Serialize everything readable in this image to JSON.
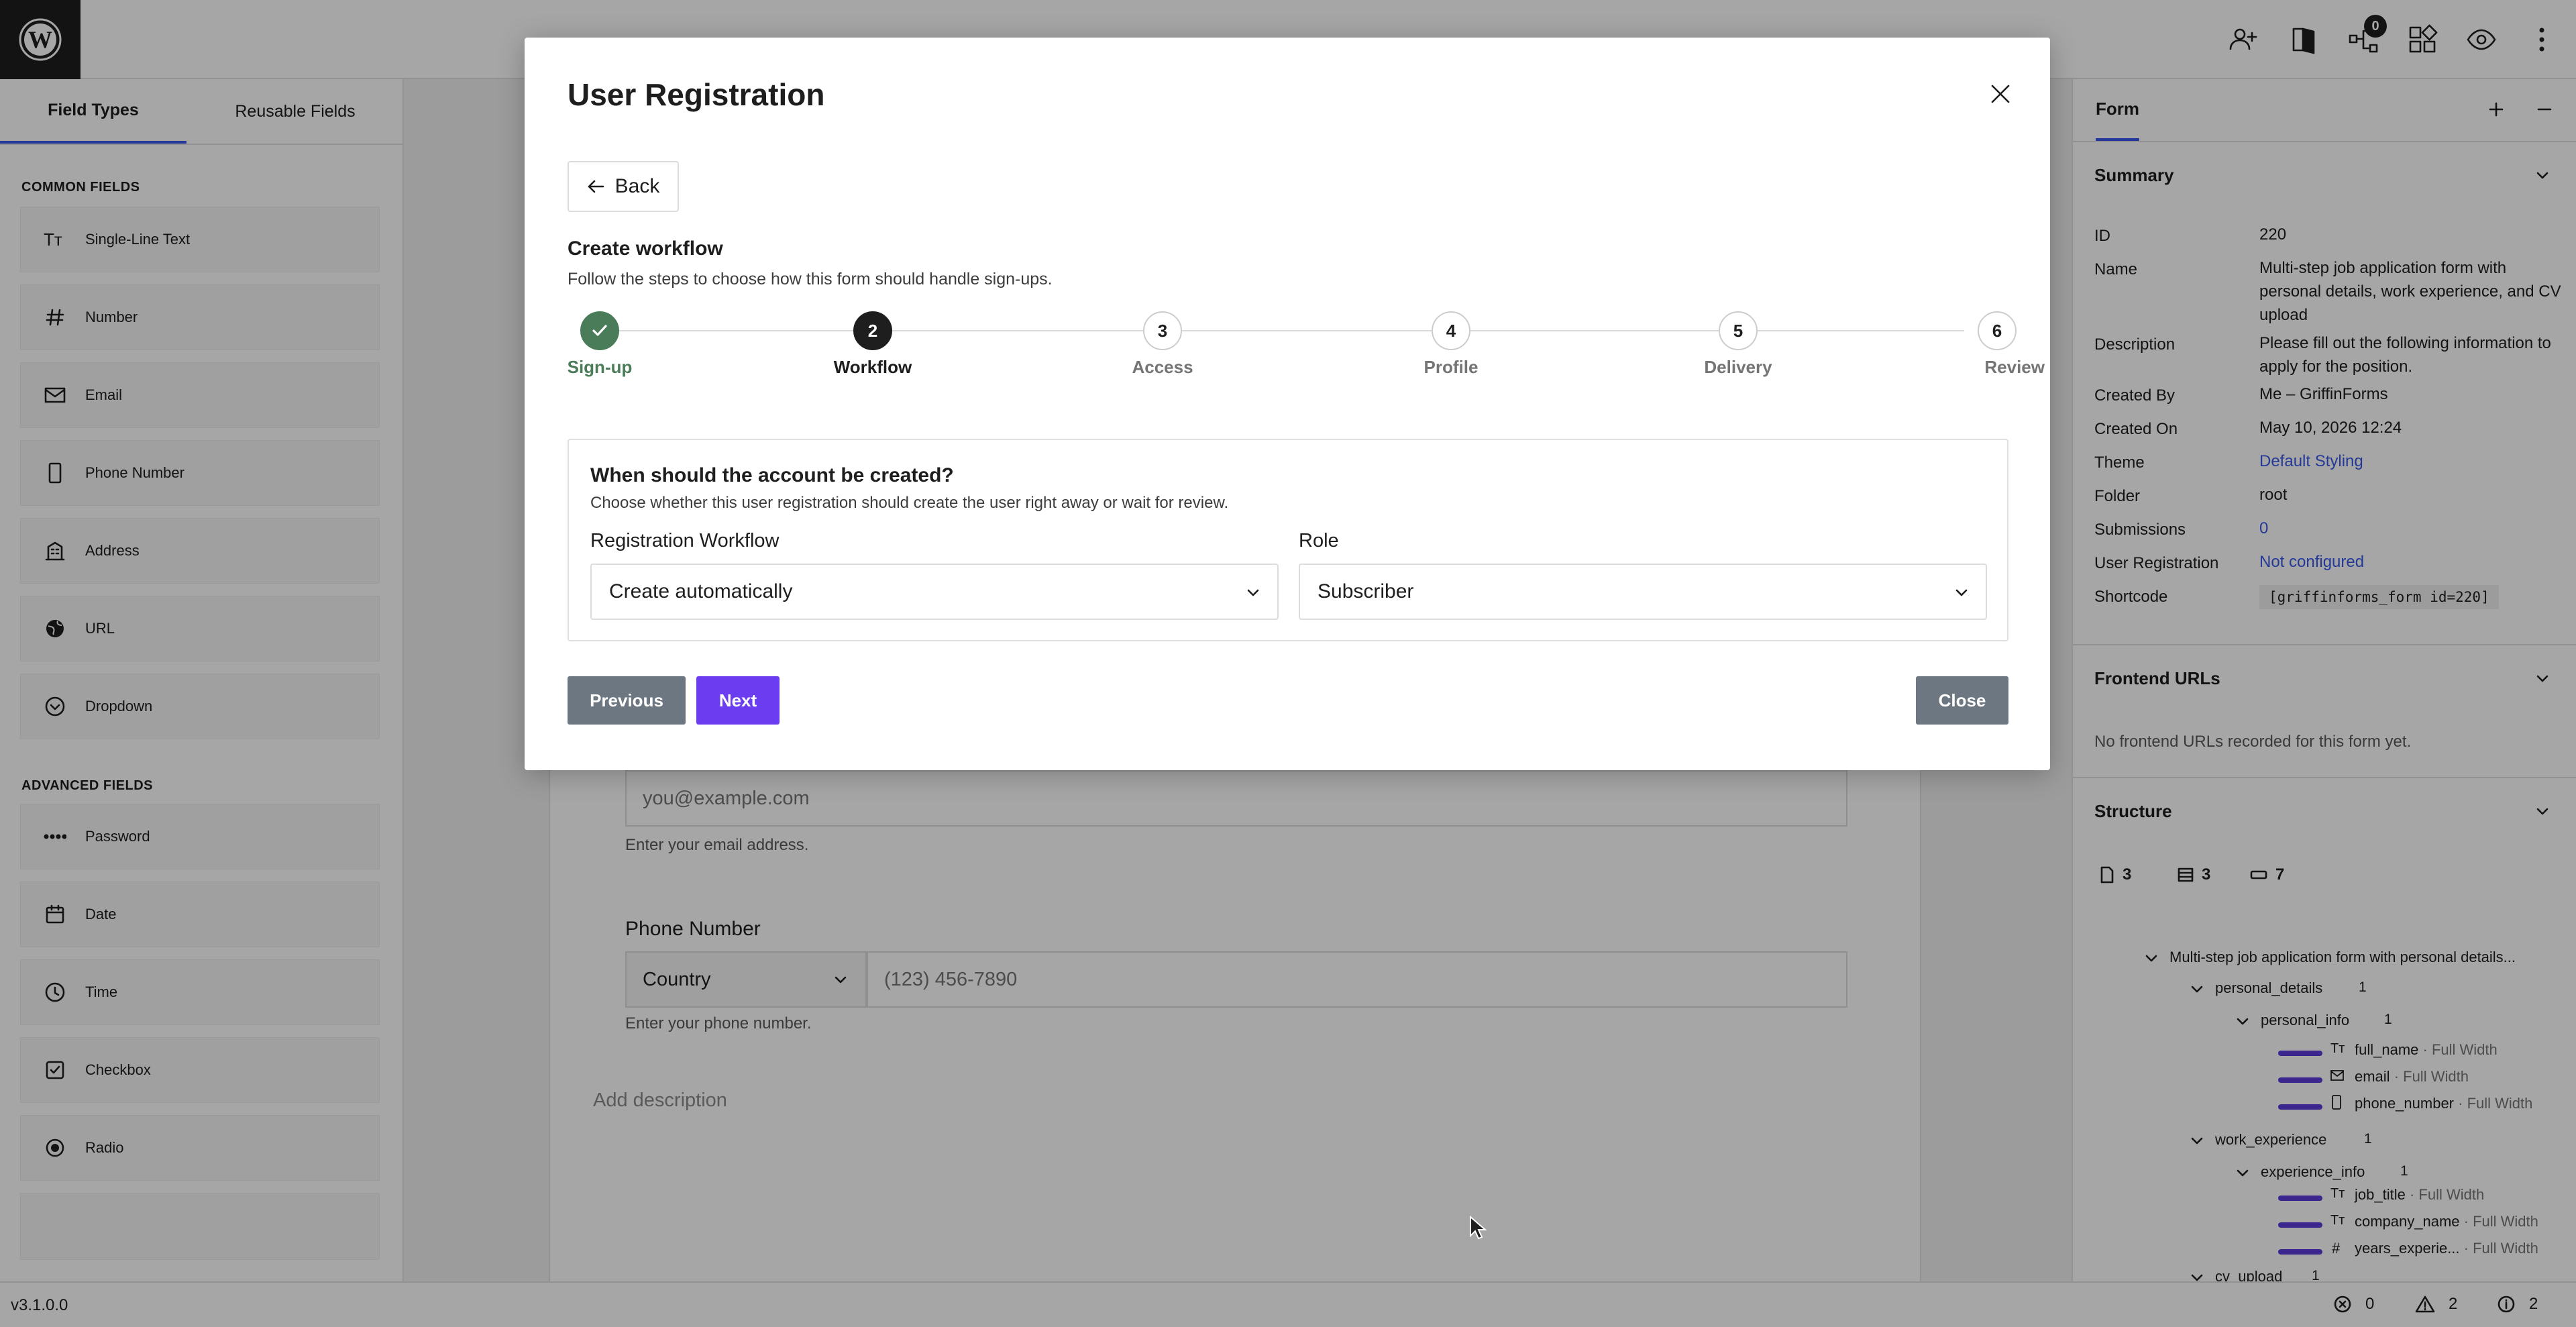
{
  "topbar": {
    "notifications_badge": "0"
  },
  "left_sidebar": {
    "tabs": [
      "Field Types",
      "Reusable Fields"
    ],
    "common_heading": "COMMON FIELDS",
    "common_fields": [
      "Single-Line Text",
      "Number",
      "Email",
      "Phone Number",
      "Address",
      "URL",
      "Dropdown"
    ],
    "advanced_heading": "ADVANCED FIELDS",
    "advanced_fields": [
      "Password",
      "Date",
      "Time",
      "Checkbox",
      "Radio"
    ]
  },
  "canvas": {
    "email_placeholder": "you@example.com",
    "email_help": "Enter your email address.",
    "phone_label": "Phone Number",
    "country_placeholder": "Country",
    "phone_placeholder": "(123) 456-7890",
    "phone_help": "Enter your phone number.",
    "add_description": "Add description"
  },
  "right_sidebar": {
    "tab": "Form",
    "summary": {
      "heading": "Summary",
      "rows": [
        {
          "label": "ID",
          "value": "220"
        },
        {
          "label": "Name",
          "value": "Multi-step job application form with personal details, work experience, and CV upload"
        },
        {
          "label": "Description",
          "value": "Please fill out the following information to apply for the position."
        },
        {
          "label": "Created By",
          "value": "Me – GriffinForms"
        },
        {
          "label": "Created On",
          "value": "May 10, 2026 12:24"
        },
        {
          "label": "Theme",
          "value": "Default Styling"
        },
        {
          "label": "Folder",
          "value": "root"
        },
        {
          "label": "Submissions",
          "value": "0"
        },
        {
          "label": "User Registration",
          "value": "Not configured"
        },
        {
          "label": "Shortcode",
          "value": "[griffinforms_form id=220]"
        }
      ]
    },
    "frontend_urls": {
      "heading": "Frontend URLs",
      "empty": "No frontend URLs recorded for this form yet."
    },
    "structure": {
      "heading": "Structure",
      "counts": [
        "3",
        "3",
        "7"
      ],
      "root": "Multi-step job application form with personal details...",
      "pages": [
        {
          "name": "personal_details",
          "count": "1",
          "row": {
            "name": "personal_info",
            "count": "1"
          },
          "fields": [
            {
              "name": "full_name",
              "width": " · Full Width"
            },
            {
              "name": "email",
              "width": " · Full Width"
            },
            {
              "name": "phone_number",
              "width": " · Full Width"
            }
          ]
        },
        {
          "name": "work_experience",
          "count": "1",
          "row": {
            "name": "experience_info",
            "count": "1"
          },
          "fields": [
            {
              "name": "job_title",
              "width": " · Full Width"
            },
            {
              "name": "company_name",
              "width": " · Full Width"
            },
            {
              "name": "years_experie...",
              "width": " · Full Width"
            }
          ]
        },
        {
          "name": "cv_upload",
          "count": "1"
        }
      ]
    }
  },
  "statusbar": {
    "version": "v3.1.0.0",
    "errors": "0",
    "warnings": "2",
    "info": "2"
  },
  "modal": {
    "title": "User Registration",
    "back_label": "Back",
    "section_title": "Create workflow",
    "section_subtitle": "Follow the steps to choose how this form should handle sign-ups.",
    "steps": [
      {
        "num": "✓",
        "label": "Sign-up",
        "state": "done"
      },
      {
        "num": "2",
        "label": "Workflow",
        "state": "current"
      },
      {
        "num": "3",
        "label": "Access",
        "state": "todo"
      },
      {
        "num": "4",
        "label": "Profile",
        "state": "todo"
      },
      {
        "num": "5",
        "label": "Delivery",
        "state": "todo"
      },
      {
        "num": "6",
        "label": "Review",
        "state": "todo"
      }
    ],
    "card_title": "When should the account be created?",
    "card_subtitle": "Choose whether this user registration should create the user right away or wait for review.",
    "workflow_label": "Registration Workflow",
    "workflow_value": "Create automatically",
    "role_label": "Role",
    "role_value": "Subscriber",
    "previous_label": "Previous",
    "next_label": "Next",
    "close_label": "Close"
  },
  "colors": {
    "accent": "#6b3cf0",
    "done": "#4a7c59",
    "link": "#3858e9",
    "gray_button": "#6c7781"
  }
}
